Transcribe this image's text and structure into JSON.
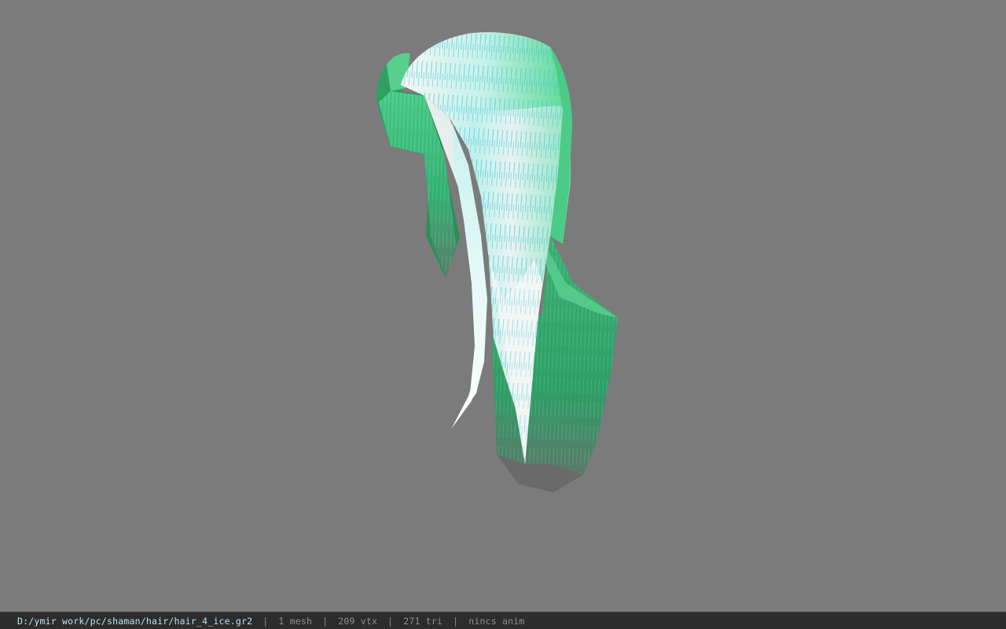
{
  "viewport": {
    "background_color": "#7b7b7b",
    "model_colors": {
      "green": "#3cbd78",
      "light_green": "#6fe0a0",
      "white": "#f2f4f4",
      "cyan_streak": "#37c8d2",
      "shadow_grey": "#6f6f6f"
    }
  },
  "statusbar": {
    "file_path": "D:/ymir work/pc/shaman/hair/hair_4_ice.gr2",
    "separator": "|",
    "mesh_count": "1 mesh",
    "vertex_count": "209 vtx",
    "triangle_count": "271 tri",
    "anim_status": "nincs anim"
  }
}
